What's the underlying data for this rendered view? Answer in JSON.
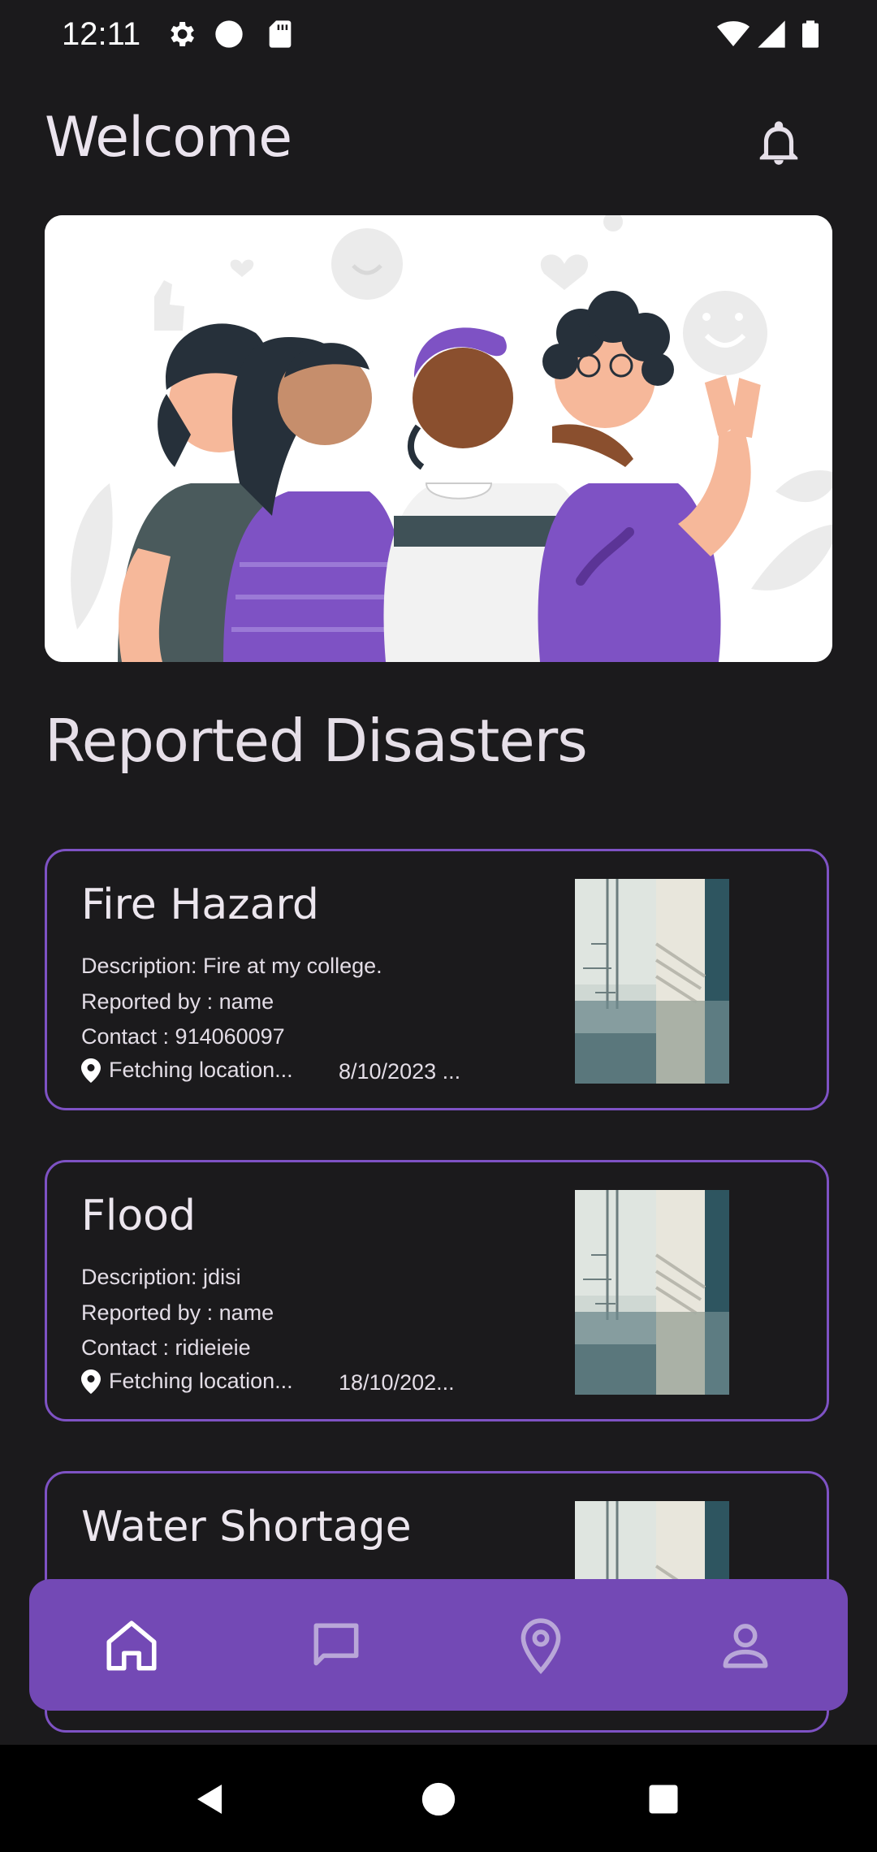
{
  "status_bar": {
    "time": "12:11",
    "left_icons": [
      "gear-icon",
      "circle-icon",
      "sd-card-icon"
    ],
    "right_icons": [
      "wifi-icon",
      "signal-icon",
      "battery-icon"
    ]
  },
  "header": {
    "title": "Welcome",
    "notification_icon": "bell-icon"
  },
  "hero": {
    "illustration": "group-of-friends-illustration"
  },
  "section": {
    "title": "Reported Disasters"
  },
  "cards": [
    {
      "title": "Fire Hazard",
      "description": "Description: Fire at my college.",
      "reported_by": "Reported by : name",
      "contact": "Contact : 914060097",
      "location": "Fetching location...",
      "date": "8/10/2023 ..."
    },
    {
      "title": "Flood",
      "description": "Description: jdisi",
      "reported_by": "Reported by : name",
      "contact": "Contact : ridieieie",
      "location": "Fetching location...",
      "date": "18/10/202..."
    },
    {
      "title": "Water Shortage",
      "description": "",
      "reported_by": "",
      "contact": "",
      "location": "",
      "date": ""
    }
  ],
  "bottom_nav": {
    "items": [
      "home-icon",
      "chat-icon",
      "location-pin-icon",
      "person-icon"
    ],
    "active": "home-icon"
  },
  "system_nav": {
    "items": [
      "back-icon",
      "home-circle-icon",
      "recents-icon"
    ]
  },
  "colors": {
    "background": "#1b1a1c",
    "accent": "#7349b5",
    "card_border": "#7e52c4",
    "text": "#e8e3ea"
  }
}
